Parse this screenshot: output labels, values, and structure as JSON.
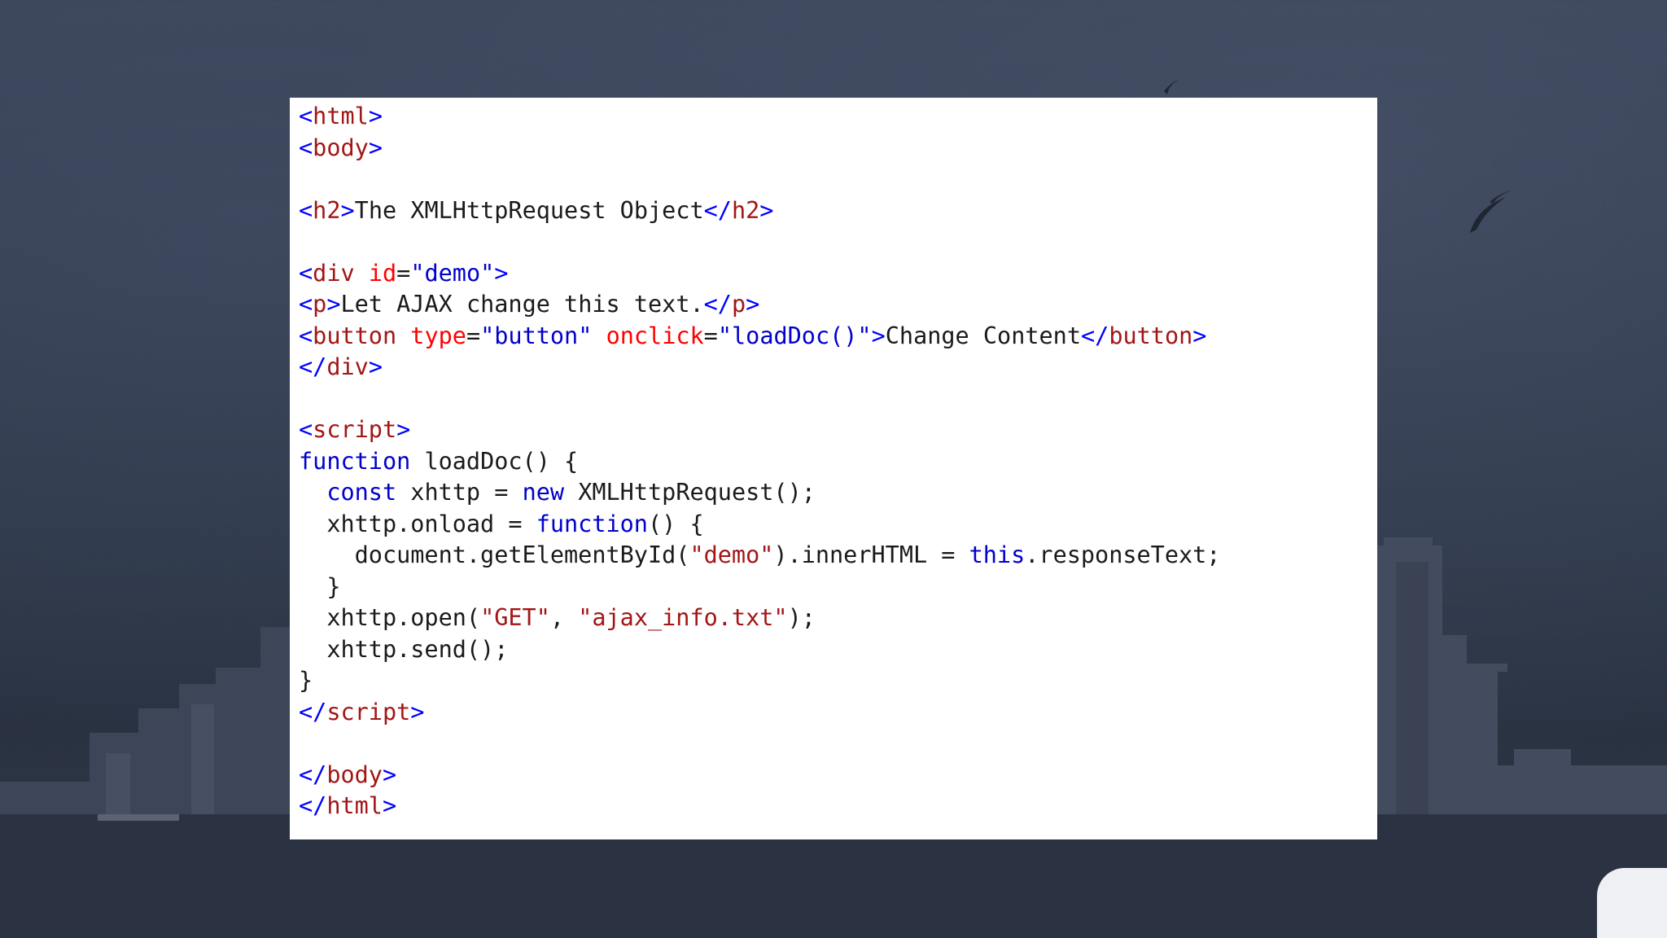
{
  "code_lines": [
    [
      [
        "br",
        "<"
      ],
      [
        "tag",
        "html"
      ],
      [
        "br",
        ">"
      ]
    ],
    [
      [
        "br",
        "<"
      ],
      [
        "tag",
        "body"
      ],
      [
        "br",
        ">"
      ]
    ],
    [],
    [
      [
        "br",
        "<"
      ],
      [
        "tag",
        "h2"
      ],
      [
        "br",
        ">"
      ],
      [
        "plain",
        "The XMLHttpRequest Object"
      ],
      [
        "br",
        "</"
      ],
      [
        "tag",
        "h2"
      ],
      [
        "br",
        ">"
      ]
    ],
    [],
    [
      [
        "br",
        "<"
      ],
      [
        "tag",
        "div"
      ],
      [
        "plain",
        " "
      ],
      [
        "attr",
        "id"
      ],
      [
        "plain",
        "="
      ],
      [
        "val",
        "\"demo\""
      ],
      [
        "br",
        ">"
      ]
    ],
    [
      [
        "br",
        "<"
      ],
      [
        "tag",
        "p"
      ],
      [
        "br",
        ">"
      ],
      [
        "plain",
        "Let AJAX change this text."
      ],
      [
        "br",
        "</"
      ],
      [
        "tag",
        "p"
      ],
      [
        "br",
        ">"
      ]
    ],
    [
      [
        "br",
        "<"
      ],
      [
        "tag",
        "button"
      ],
      [
        "plain",
        " "
      ],
      [
        "attr",
        "type"
      ],
      [
        "plain",
        "="
      ],
      [
        "val",
        "\"button\""
      ],
      [
        "plain",
        " "
      ],
      [
        "attr",
        "onclick"
      ],
      [
        "plain",
        "="
      ],
      [
        "val",
        "\"loadDoc()\""
      ],
      [
        "br",
        ">"
      ],
      [
        "plain",
        "Change Content"
      ],
      [
        "br",
        "</"
      ],
      [
        "tag",
        "button"
      ],
      [
        "br",
        ">"
      ]
    ],
    [
      [
        "br",
        "</"
      ],
      [
        "tag",
        "div"
      ],
      [
        "br",
        ">"
      ]
    ],
    [],
    [
      [
        "br",
        "<"
      ],
      [
        "tag",
        "script"
      ],
      [
        "br",
        ">"
      ]
    ],
    [
      [
        "kw",
        "function"
      ],
      [
        "plain",
        " loadDoc() {"
      ]
    ],
    [
      [
        "plain",
        "  "
      ],
      [
        "kw",
        "const"
      ],
      [
        "plain",
        " xhttp = "
      ],
      [
        "kw",
        "new"
      ],
      [
        "plain",
        " XMLHttpRequest();"
      ]
    ],
    [
      [
        "plain",
        "  xhttp.onload = "
      ],
      [
        "kw",
        "function"
      ],
      [
        "plain",
        "() {"
      ]
    ],
    [
      [
        "plain",
        "    document.getElementById("
      ],
      [
        "str",
        "\"demo\""
      ],
      [
        "plain",
        ").innerHTML = "
      ],
      [
        "kw",
        "this"
      ],
      [
        "plain",
        ".responseText;"
      ]
    ],
    [
      [
        "plain",
        "  }"
      ]
    ],
    [
      [
        "plain",
        "  xhttp.open("
      ],
      [
        "str",
        "\"GET\""
      ],
      [
        "plain",
        ", "
      ],
      [
        "str",
        "\"ajax_info.txt\""
      ],
      [
        "plain",
        ");"
      ]
    ],
    [
      [
        "plain",
        "  xhttp.send();"
      ]
    ],
    [
      [
        "plain",
        "}"
      ]
    ],
    [
      [
        "br",
        "</"
      ],
      [
        "tag",
        "script"
      ],
      [
        "br",
        ">"
      ]
    ],
    [],
    [
      [
        "br",
        "</"
      ],
      [
        "tag",
        "body"
      ],
      [
        "br",
        ">"
      ]
    ],
    [
      [
        "br",
        "</"
      ],
      [
        "tag",
        "html"
      ],
      [
        "br",
        ">"
      ]
    ]
  ],
  "colors": {
    "tag_name": "#a31515",
    "tag_bracket": "#0000ff",
    "attribute_name": "#ff0000",
    "attribute_value": "#0000cd",
    "keyword": "#0000cd",
    "string": "#a31515",
    "plain_text": "#1a1a1a",
    "panel_background": "#ffffff",
    "page_background": "#333d51"
  }
}
